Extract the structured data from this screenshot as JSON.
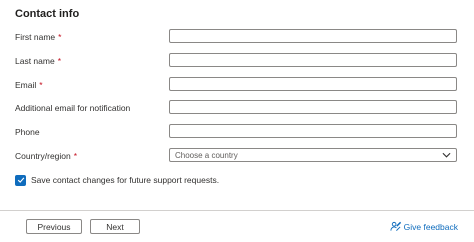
{
  "form": {
    "section_title": "Contact info",
    "required_marker": "*",
    "fields": [
      {
        "label": "First name",
        "required": true,
        "value": ""
      },
      {
        "label": "Last name",
        "required": true,
        "value": ""
      },
      {
        "label": "Email",
        "required": true,
        "value": ""
      },
      {
        "label": "Additional email for notification",
        "required": false,
        "value": ""
      },
      {
        "label": "Phone",
        "required": false,
        "value": ""
      }
    ],
    "country": {
      "label": "Country/region",
      "required": true,
      "placeholder": "Choose a country",
      "icon": "chevron-down-icon"
    },
    "save_checkbox": {
      "label": "Save contact changes for future support requests.",
      "checked": true,
      "icon": "checkmark-icon"
    }
  },
  "footer": {
    "previous_label": "Previous",
    "next_label": "Next",
    "feedback_label": "Give feedback",
    "feedback_icon": "feedback-person-icon"
  },
  "colors": {
    "accent": "#0f6cbd",
    "required": "#c50f1f",
    "border": "#8a8886",
    "text": "#323130"
  }
}
